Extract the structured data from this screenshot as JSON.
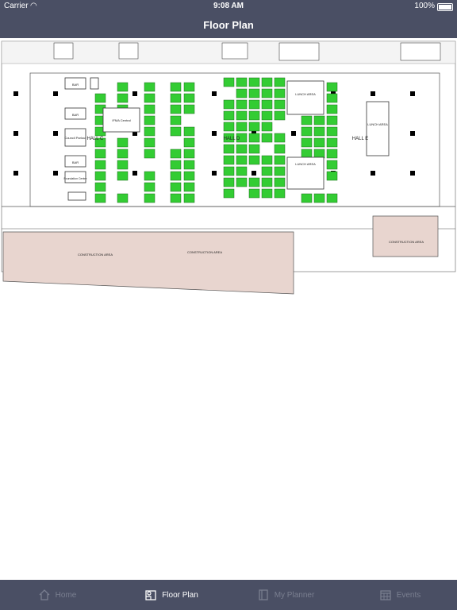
{
  "status_bar": {
    "carrier": "Carrier",
    "time": "9:08 AM",
    "battery": "100%"
  },
  "nav": {
    "title": "Floor Plan"
  },
  "floorplan": {
    "halls": [
      "HALL C",
      "HALL D",
      "HALL E"
    ],
    "rooms": [
      "BAR",
      "BAR",
      "Council Parlour",
      "BAR",
      "Foundation Centre",
      "IFMA Central",
      "LUNCH AREA",
      "LUNCH AREA",
      "LUNCH AREA"
    ],
    "construction_label": "CONSTRUCTION AREA"
  },
  "tabs": [
    {
      "label": "Home",
      "icon": "home-icon",
      "active": false
    },
    {
      "label": "Floor Plan",
      "icon": "floor-plan-icon",
      "active": true
    },
    {
      "label": "My Planner",
      "icon": "planner-icon",
      "active": false
    },
    {
      "label": "Events",
      "icon": "calendar-icon",
      "active": false
    }
  ],
  "colors": {
    "bar": "#4a4f64",
    "booth": "#33cc33",
    "construction": "#e8d5cf"
  }
}
